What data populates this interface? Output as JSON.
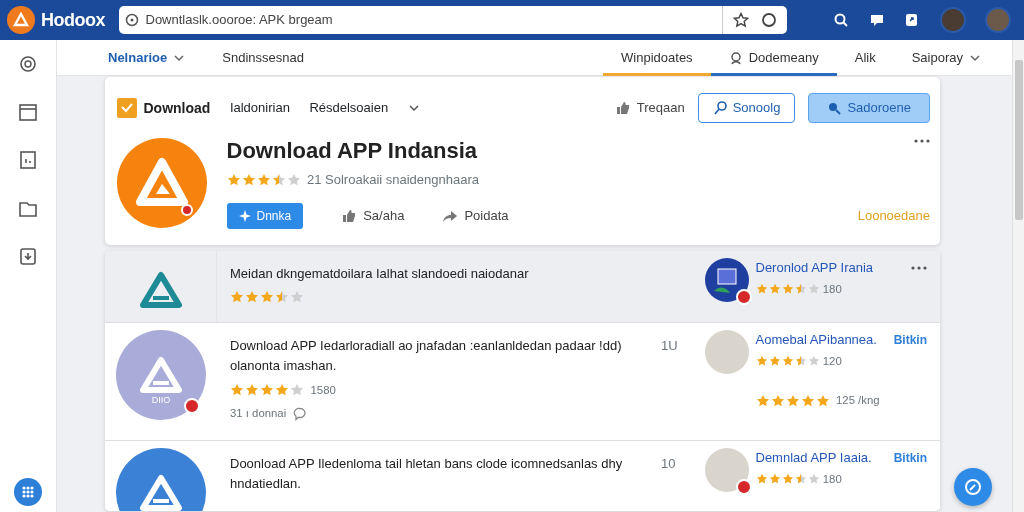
{
  "brand": {
    "name": "Hodoox"
  },
  "address_bar": {
    "value": "Downtlaslk.oooroe: APK brgeam"
  },
  "subnav": {
    "left": [
      {
        "label": "Nelnarioe",
        "selected": true,
        "dropdown": true
      },
      {
        "label": "Sndinssesnad",
        "selected": false,
        "dropdown": false
      }
    ],
    "right": [
      {
        "label": "Winpidoates",
        "color": "#f0a830",
        "icon": false,
        "dropdown": false
      },
      {
        "label": "Dodemeany",
        "color": "#2a6bbf",
        "icon": true,
        "dropdown": false
      },
      {
        "label": "Alik",
        "icon": false,
        "dropdown": false
      },
      {
        "label": "Saiporay",
        "icon": false,
        "dropdown": true
      }
    ]
  },
  "app_card": {
    "toolbar": {
      "brand": "Download",
      "tabs": [
        "Ialdonirian",
        "Résdelsoaien"
      ],
      "like": "Treqaan",
      "outline_button": "Sonoolg",
      "filled_button": "Sadoroene"
    },
    "title": "Download APP Indansia",
    "stars": 3.5,
    "rating_text": "21 Solroakaii snaidengnhaara",
    "install": "Dnnka",
    "like": "Sa/aha",
    "share": "Poidata",
    "footer_link": "Loonoedane"
  },
  "results": [
    {
      "kind": "outline",
      "selected": true,
      "verified": false,
      "text": "Meidan dkngematdoilara Ialhat slandoedi naiodanar",
      "stars": 3.5,
      "related": {
        "kind": "app",
        "badge": true,
        "title": "Deronlod APP Irania",
        "stars": 3.5,
        "count": "180",
        "more": true
      }
    },
    {
      "kind": "lavender",
      "selected": false,
      "verified": true,
      "icon_label": "DIIO",
      "text": "Download APP Iedarloradiall ao jnafadan :eanlanldedan padaar !dd) olanonta imashan.",
      "stars": 4,
      "count": "1580",
      "comments": "31 ı donnai",
      "number": "1U",
      "related": {
        "kind": "photo",
        "badge": false,
        "title": "Aomebal APibannea.",
        "tag": "Bitkin",
        "stars": 3.5,
        "count": "120",
        "more": false,
        "extra": {
          "stars": 5,
          "count": "125 /kng"
        }
      }
    },
    {
      "kind": "blue",
      "selected": false,
      "verified": false,
      "text": "Doonload APP Iledenloma tail hletan bans clode icomnedsanlas dhy hndatiedlan.",
      "number": "10",
      "related": {
        "kind": "photo",
        "badge": true,
        "title": "Demnlad APP Iaaia.",
        "tag": "Bitkin",
        "stars": 3.5,
        "count": "180",
        "more": false
      }
    }
  ]
}
